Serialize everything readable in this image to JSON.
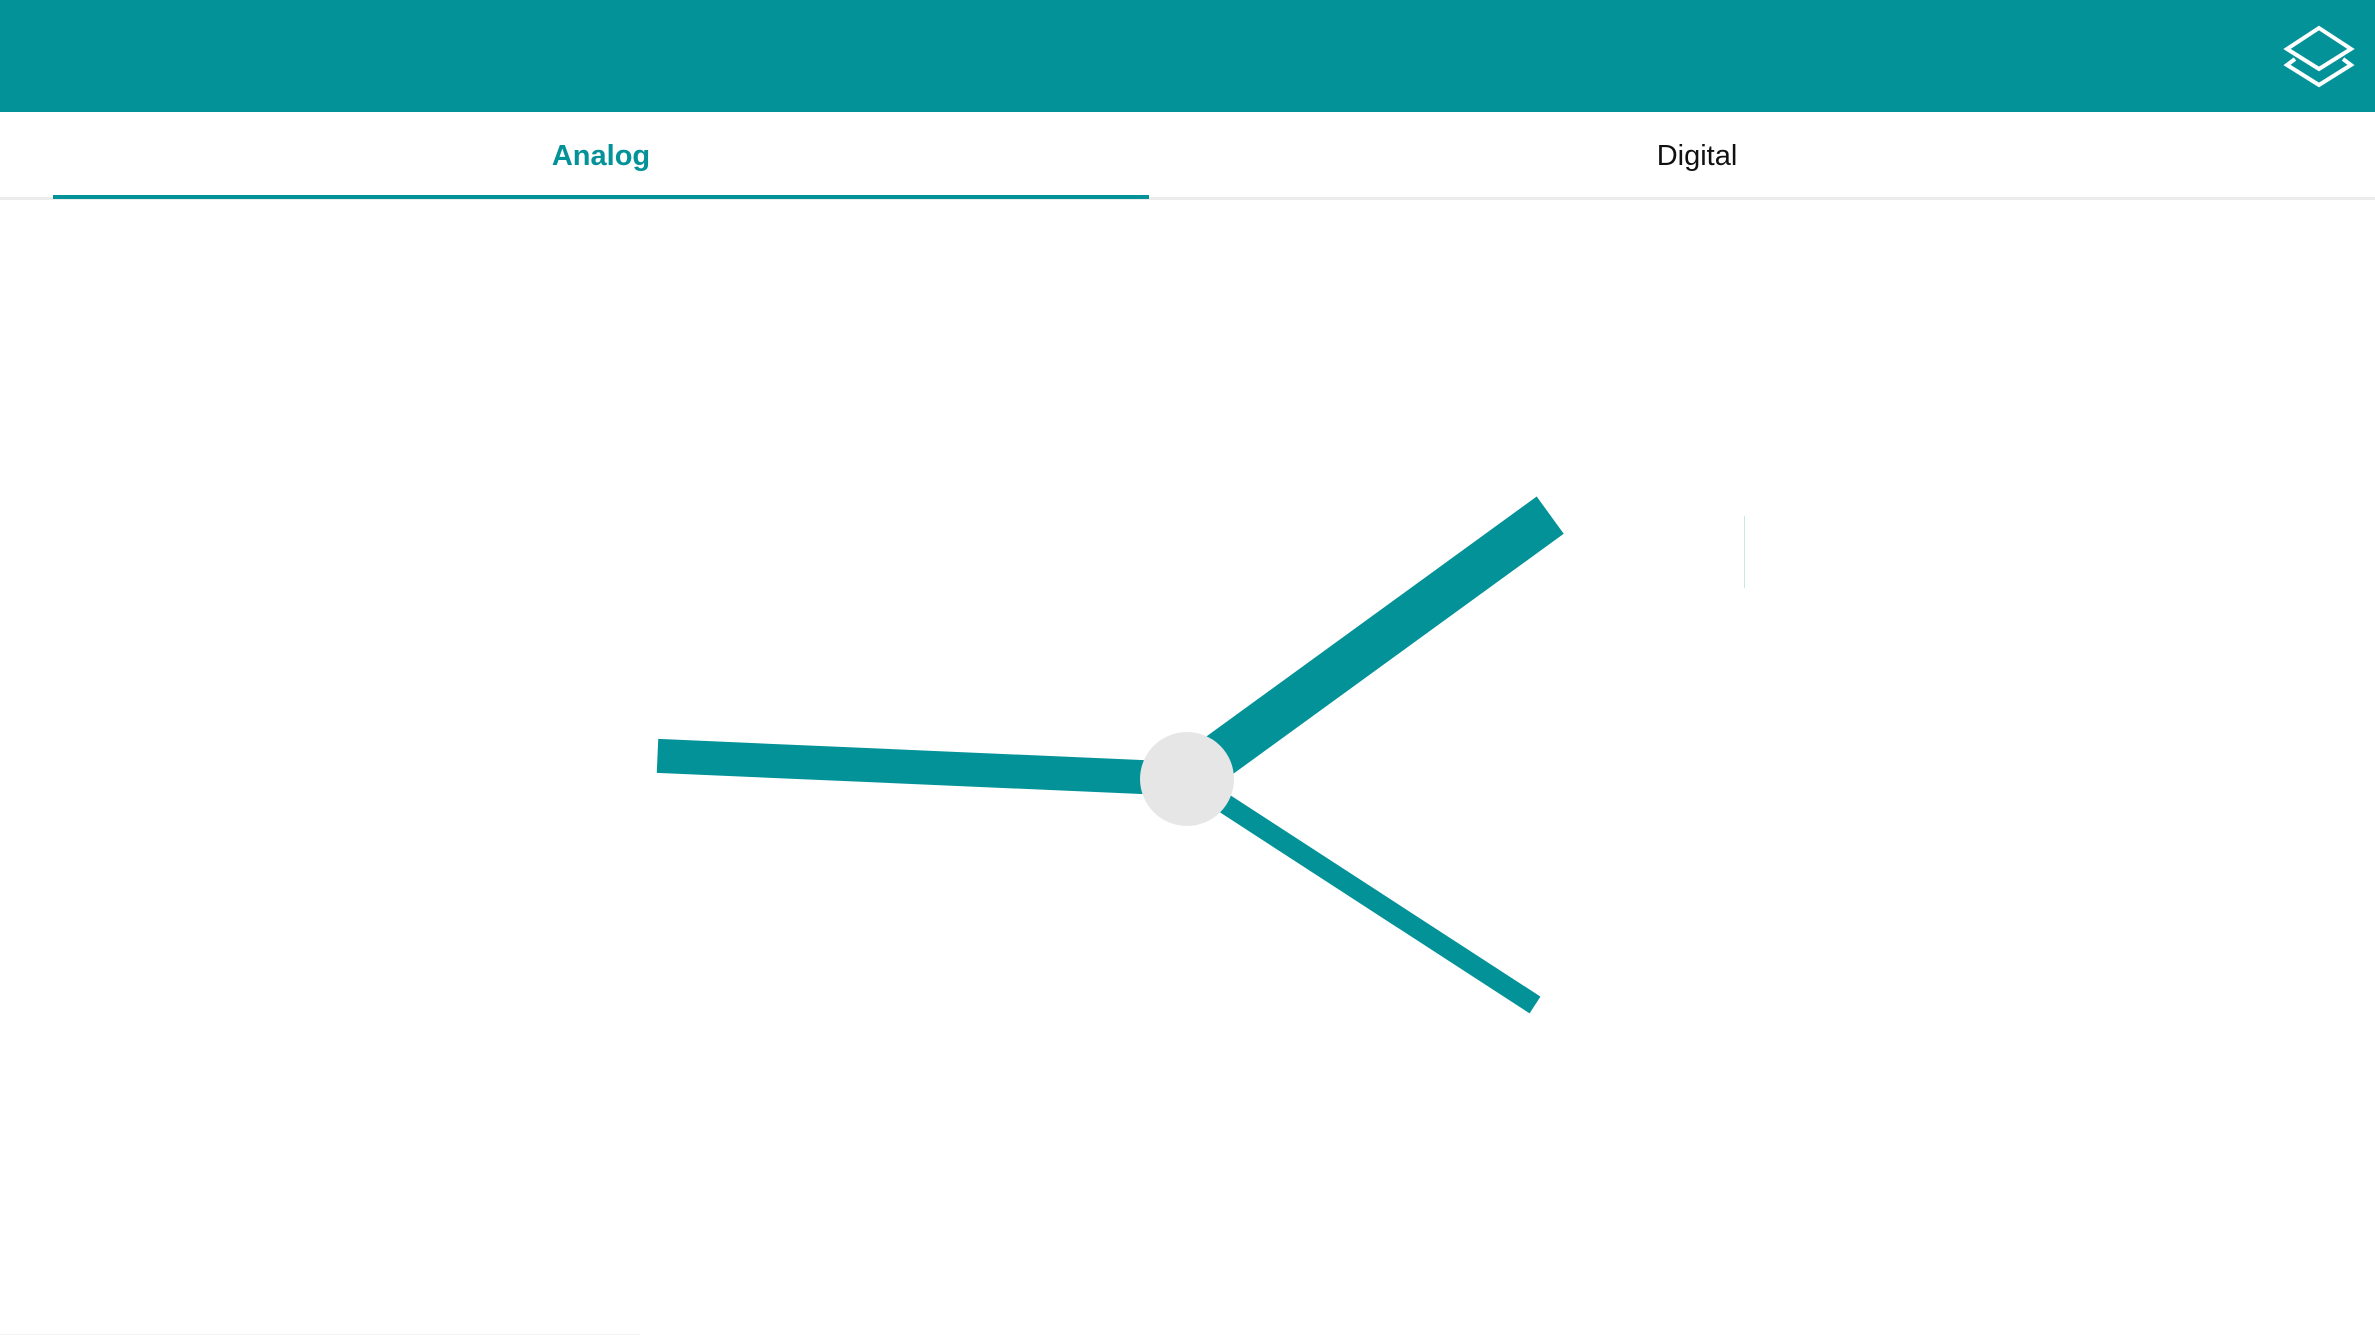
{
  "colors": {
    "accent": "#029298",
    "hub": "#e6e6e6",
    "tab_active": "#029298",
    "tab_inactive": "#111111"
  },
  "header": {
    "layers_icon": "layers-icon"
  },
  "tabs": [
    {
      "label": "Analog",
      "active": true
    },
    {
      "label": "Digital",
      "active": false
    }
  ],
  "clock": {
    "face": "analog",
    "hands": [
      {
        "name": "hour-hand",
        "angle_deg": 54
      },
      {
        "name": "minute-hand",
        "angle_deg": 272.5
      },
      {
        "name": "second-hand",
        "angle_deg": 123
      }
    ]
  }
}
